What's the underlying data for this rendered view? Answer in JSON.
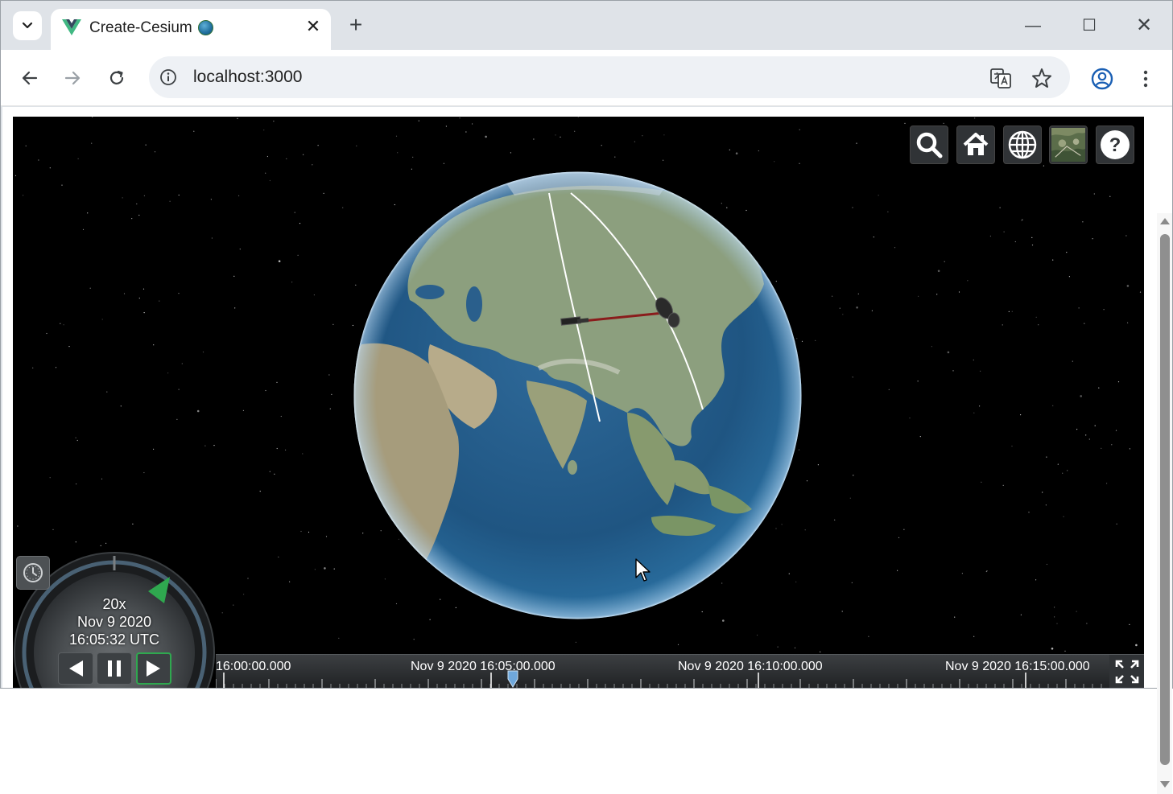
{
  "browser": {
    "tab_title": "Create-Cesium",
    "tab_close": "✕",
    "new_tab": "+",
    "url": "localhost:3000",
    "window_controls": {
      "minimize": "—",
      "maximize": "☐",
      "close": "✕"
    }
  },
  "cesium": {
    "toolbar_icons": [
      "search-icon",
      "home-icon",
      "globe-icon",
      "imagery-layer-icon",
      "help-icon"
    ],
    "help_label": "?",
    "animation": {
      "speed": "20x",
      "date": "Nov 9 2020",
      "time": "16:05:32 UTC"
    },
    "timeline": {
      "labels": [
        "16:00:00.000",
        "Nov 9 2020 16:05:00.000",
        "Nov 9 2020 16:10:00.000",
        "Nov 9 2020 16:15:00.000"
      ]
    }
  },
  "colors": {
    "accent_play": "#2fa84f",
    "widget_bg": "#303336",
    "sky": "#000000",
    "orbit": "#ffffff"
  }
}
